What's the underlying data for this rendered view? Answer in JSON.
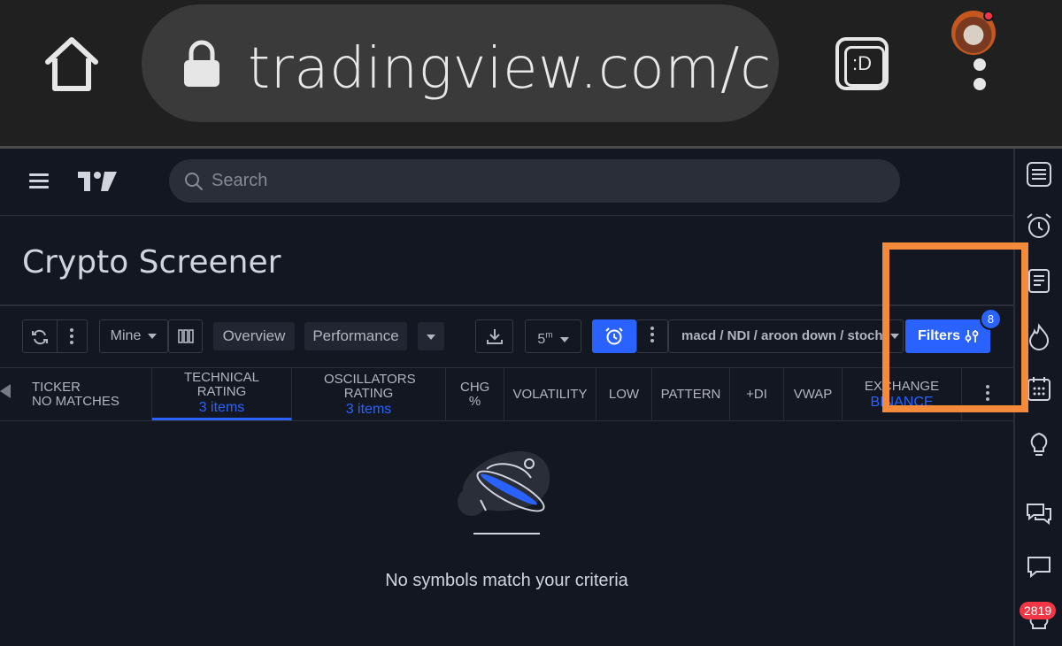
{
  "browser": {
    "url": "tradingview.com/cry",
    "extension_label": ":D"
  },
  "header": {
    "search_placeholder": "Search"
  },
  "page": {
    "title": "Crypto Screener"
  },
  "toolbar": {
    "watchlist": "Mine",
    "tab_overview": "Overview",
    "tab_performance": "Performance",
    "interval": "5m",
    "interval_main": "5",
    "interval_sup": "m",
    "filter_summary": "macd / NDI / aroon down / stoch",
    "filters_label": "Filters",
    "filters_count": "8"
  },
  "table": {
    "ticker_header": "TICKER",
    "ticker_status": "NO MATCHES",
    "columns": [
      {
        "label": "TECHNICAL RATING",
        "sub": "3 items"
      },
      {
        "label": "OSCILLATORS RATING",
        "sub": "3 items"
      },
      {
        "label": "CHG %",
        "sub": ""
      },
      {
        "label": "VOLATILITY",
        "sub": ""
      },
      {
        "label": "LOW",
        "sub": ""
      },
      {
        "label": "PATTERN",
        "sub": ""
      },
      {
        "label": "+DI",
        "sub": ""
      },
      {
        "label": "VWAP",
        "sub": ""
      },
      {
        "label": "EXCHANGE",
        "sub": "BINANCE"
      }
    ]
  },
  "empty_state": {
    "message": "No symbols match your criteria"
  },
  "right_sidebar": {
    "notification_count": "2819"
  },
  "colors": {
    "accent": "#2962ff",
    "highlight": "#f38b3a",
    "alert_red": "#f23645"
  }
}
